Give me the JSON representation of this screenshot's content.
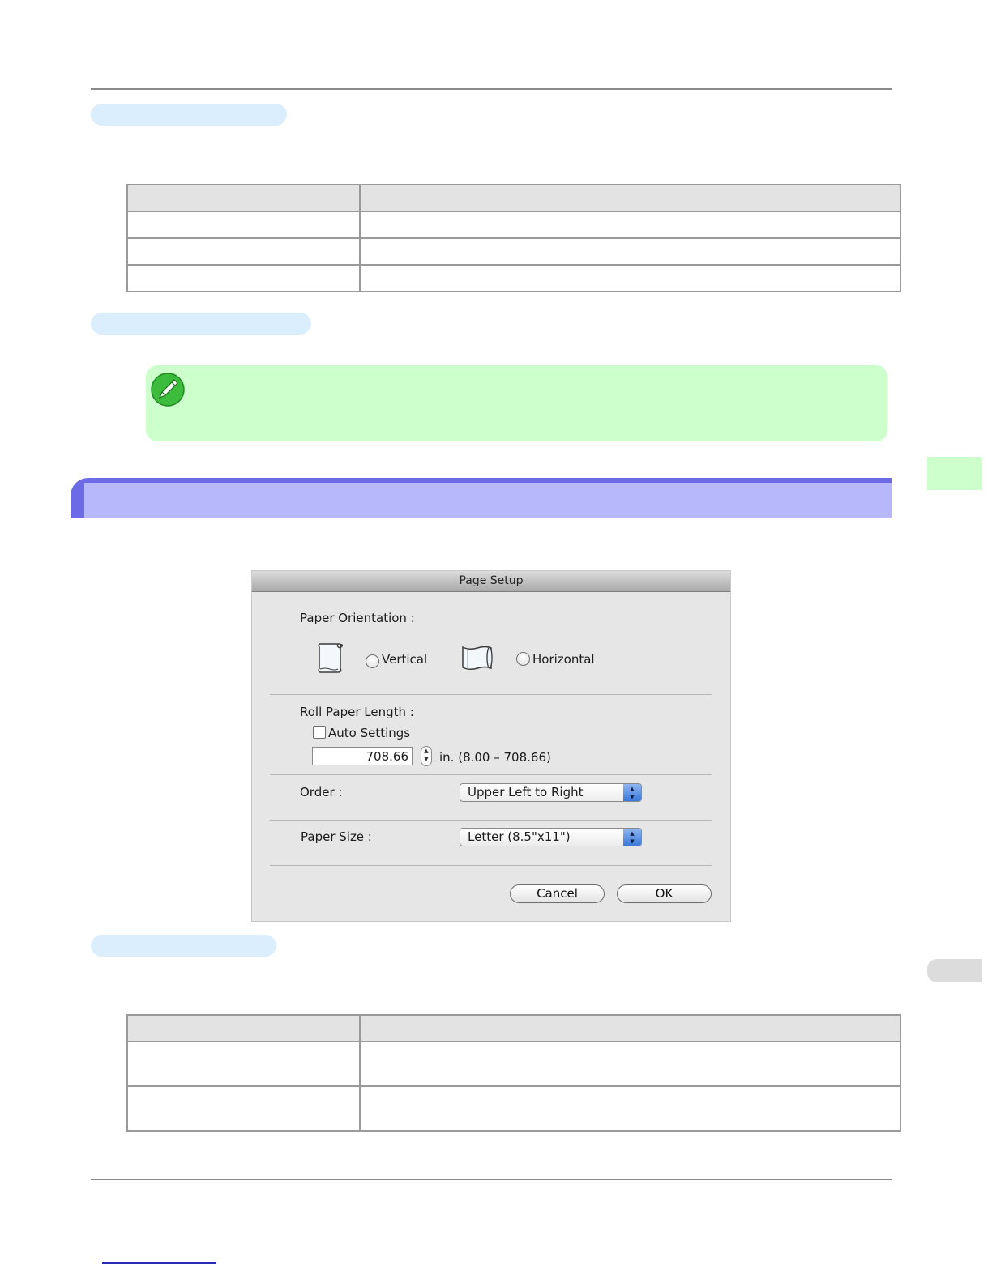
{
  "dialog": {
    "title": "Page Setup",
    "paper_orientation_label": "Paper Orientation :",
    "vertical_label": "Vertical",
    "horizontal_label": "Horizontal",
    "roll_paper_length_label": "Roll Paper Length :",
    "auto_settings_label": "Auto Settings",
    "length_value": "708.66",
    "length_range": "in. (8.00 – 708.66)",
    "order_label": "Order :",
    "order_value": "Upper Left to Right",
    "paper_size_label": "Paper Size :",
    "paper_size_value": "Letter (8.5\"x11\")",
    "cancel_label": "Cancel",
    "ok_label": "OK"
  },
  "icons": {
    "note": "pencil-note-icon",
    "vertical": "roll-paper-vertical-icon",
    "horizontal": "roll-paper-horizontal-icon"
  },
  "colors": {
    "section_pill": "#dbeefe",
    "note_background": "#ccffcc",
    "banner": "#b7b8fc",
    "banner_edge": "#6d6ae6",
    "side_tab": "#ccffcc",
    "side_tab_grey": "#dcdcdc"
  }
}
